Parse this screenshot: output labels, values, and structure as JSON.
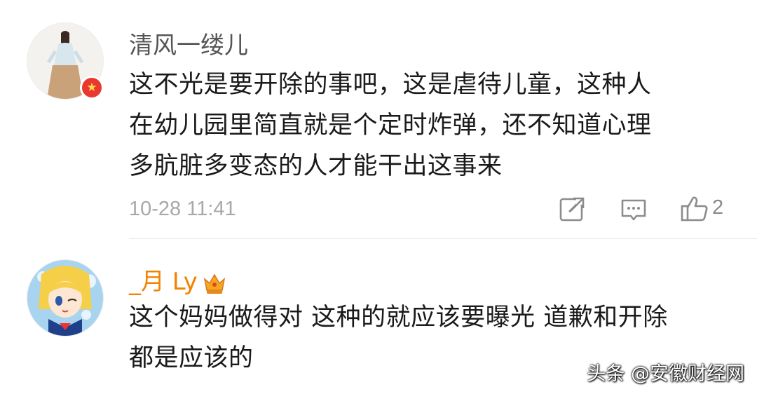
{
  "comments": [
    {
      "username": "清风一缕儿",
      "avatar_icon": "girl-avatar",
      "badge_icon": "verified-star-badge",
      "badge_glyph": "★",
      "text_lines": [
        "这不光是要开除的事吧，这是虐待儿童，这种人",
        "在幼儿园里简直就是个定时炸弹，还不知道心理",
        "多肮脏多变态的人才能干出这事来"
      ],
      "timestamp": "10-28 11:41",
      "actions": {
        "share_icon": "share-icon",
        "comment_icon": "comment-icon",
        "like_icon": "thumbs-up-icon",
        "like_count": "2"
      }
    },
    {
      "username": "_月 Ly",
      "username_color": "#f08400",
      "vip_icon": "crown-vip-icon",
      "avatar_icon": "anime-avatar",
      "text_lines": [
        "这个妈妈做得对 这种的就应该要曝光 道歉和开除",
        "都是应该的"
      ]
    }
  ],
  "watermark": "头条 @安徽财经网",
  "colors": {
    "username_gray": "#555555",
    "username_orange": "#f08400",
    "text": "#1a1a1a",
    "meta": "#a8a8a8",
    "badge_red": "#e8382f"
  }
}
